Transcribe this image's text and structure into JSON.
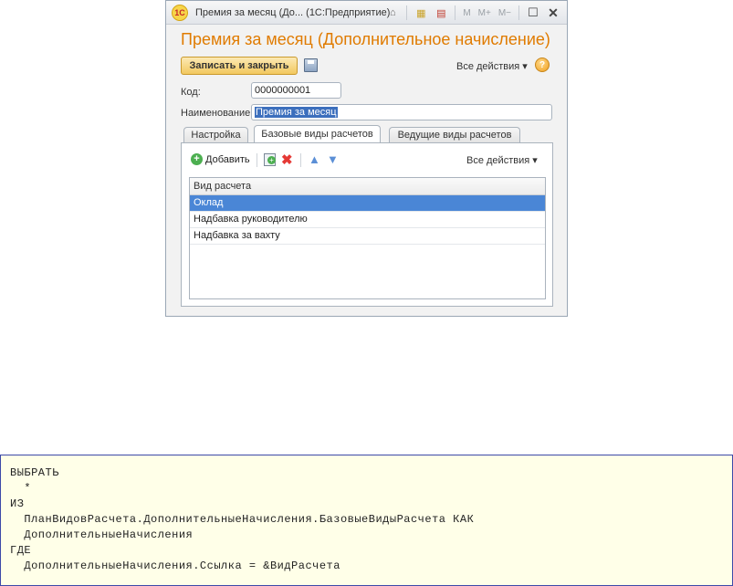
{
  "window": {
    "title": "Премия за месяц (До... (1С:Предприятие)",
    "logo": "1С",
    "toolbar": {
      "m": "M",
      "m_plus": "M+",
      "m_minus": "M−"
    }
  },
  "form": {
    "title": "Премия за месяц (Дополнительное начисление)",
    "save_close_label": "Записать и закрыть",
    "all_actions_label": "Все действия ▾",
    "help_label": "?",
    "code_label": "Код:",
    "code_value": "0000000001",
    "name_label": "Наименование:",
    "name_value": "Премия за месяц"
  },
  "tabs": [
    {
      "label": "Настройка"
    },
    {
      "label": "Базовые виды расчетов"
    },
    {
      "label": "Ведущие виды расчетов"
    }
  ],
  "panel": {
    "add_label": "Добавить",
    "all_actions_label": "Все действия ▾",
    "column_header": "Вид расчета",
    "rows": [
      {
        "label": "Оклад"
      },
      {
        "label": "Надбавка руководителю"
      },
      {
        "label": "Надбавка за вахту"
      }
    ]
  },
  "code": {
    "lines": [
      "ВЫБРАТЬ",
      "  *",
      "ИЗ",
      "  ПланВидовРасчета.ДополнительныеНачисления.БазовыеВидыРасчета КАК",
      "  ДополнительныеНачисления",
      "ГДЕ",
      "  ДополнительныеНачисления.Ссылка = &ВидРасчета"
    ]
  }
}
